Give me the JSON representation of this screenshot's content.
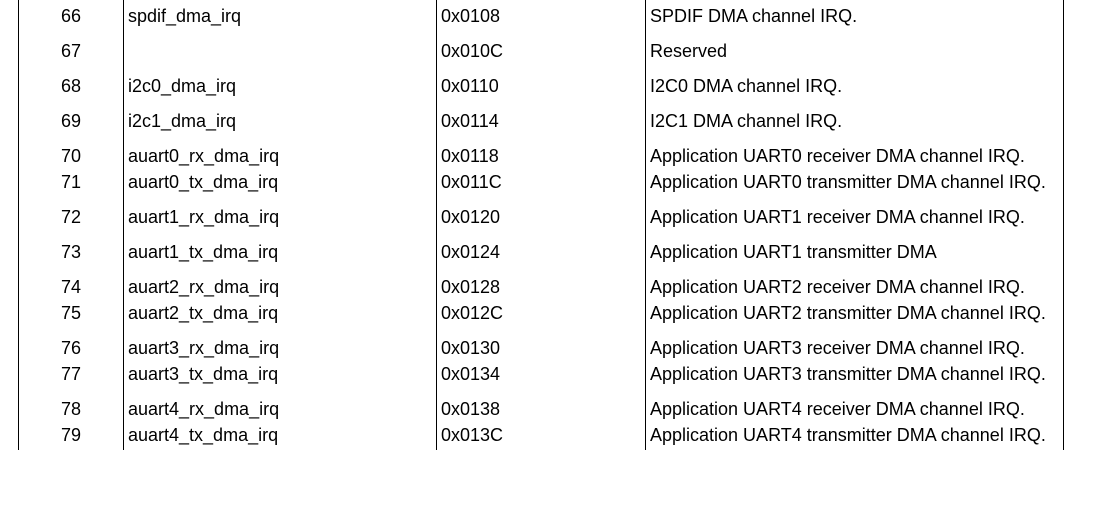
{
  "rows": [
    {
      "num": "66",
      "name": "spdif_dma_irq",
      "offset": "0x0108",
      "desc": "SPDIF DMA channel IRQ."
    },
    {
      "num": "67",
      "name": "",
      "offset": "0x010C",
      "desc": "Reserved"
    },
    {
      "num": "68",
      "name": "i2c0_dma_irq",
      "offset": "0x0110",
      "desc": "I2C0 DMA channel IRQ."
    },
    {
      "num": "69",
      "name": "i2c1_dma_irq",
      "offset": "0x0114",
      "desc": "I2C1 DMA channel IRQ."
    },
    {
      "num": "70",
      "name": "auart0_rx_dma_irq",
      "offset": "0x0118",
      "desc": "Application UART0 receiver DMA channel IRQ."
    },
    {
      "num": "71",
      "name": "auart0_tx_dma_irq",
      "offset": "0x011C",
      "desc": "Application UART0 transmitter DMA channel IRQ."
    },
    {
      "num": "72",
      "name": "auart1_rx_dma_irq",
      "offset": "0x0120",
      "desc": "Application UART1 receiver DMA channel IRQ."
    },
    {
      "num": "73",
      "name": "auart1_tx_dma_irq",
      "offset": "0x0124",
      "desc": "Application UART1 transmitter DMA"
    },
    {
      "num": "74",
      "name": "auart2_rx_dma_irq",
      "offset": "0x0128",
      "desc": "Application UART2 receiver DMA channel IRQ."
    },
    {
      "num": "75",
      "name": "auart2_tx_dma_irq",
      "offset": "0x012C",
      "desc": "Application UART2 transmitter DMA channel IRQ."
    },
    {
      "num": "76",
      "name": "auart3_rx_dma_irq",
      "offset": "0x0130",
      "desc": "Application UART3 receiver DMA channel IRQ."
    },
    {
      "num": "77",
      "name": "auart3_tx_dma_irq",
      "offset": "0x0134",
      "desc": "Application UART3 transmitter DMA channel IRQ."
    },
    {
      "num": "78",
      "name": "auart4_rx_dma_irq",
      "offset": "0x0138",
      "desc": "Application UART4 receiver DMA channel IRQ."
    },
    {
      "num": "79",
      "name": "auart4_tx_dma_irq",
      "offset": "0x013C",
      "desc": "Application UART4 transmitter DMA channel IRQ."
    }
  ]
}
